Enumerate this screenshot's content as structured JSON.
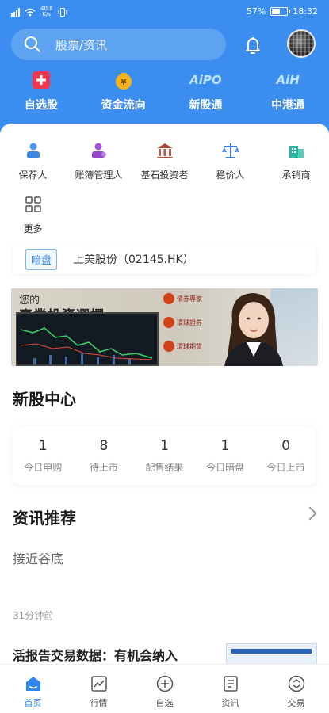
{
  "status_bar": {
    "network_speed": "40.8\nK/s",
    "battery_percent": "57%",
    "battery_level": 0.57,
    "time": "18:32"
  },
  "search": {
    "placeholder": "股票/资讯"
  },
  "quick_entries": [
    {
      "label": "自选股",
      "icon": "plus-square-icon"
    },
    {
      "label": "资金流向",
      "icon": "money-bag-icon"
    },
    {
      "label": "新股通",
      "icon": "aipo-icon",
      "glyph": "AiPO"
    },
    {
      "label": "中港通",
      "icon": "aih-icon",
      "glyph": "AiH"
    }
  ],
  "service_grid": [
    {
      "label": "保荐人",
      "icon": "sponsor-icon"
    },
    {
      "label": "账簿管理人",
      "icon": "bookrunner-icon"
    },
    {
      "label": "基石投资者",
      "icon": "bank-icon"
    },
    {
      "label": "稳价人",
      "icon": "scale-icon"
    },
    {
      "label": "承销商",
      "icon": "building-icon"
    },
    {
      "label": "更多",
      "icon": "grid-icon"
    }
  ],
  "dark_pool": {
    "tag": "暗盘",
    "stock": "上美股份（02145.HK）"
  },
  "banner": {
    "headline_small": "您的",
    "headline_big": "專業投資選擇",
    "items": [
      "債券專家",
      "環球證券",
      "環球期貨"
    ]
  },
  "ipo_center": {
    "title": "新股中心",
    "stats": [
      {
        "value": "1",
        "label": "今日申购"
      },
      {
        "value": "8",
        "label": "待上市"
      },
      {
        "value": "1",
        "label": "配售结果"
      },
      {
        "value": "1",
        "label": "今日暗盘"
      },
      {
        "value": "0",
        "label": "今日上市"
      }
    ]
  },
  "news": {
    "title": "资讯推荐",
    "first_title": "接近谷底",
    "time": "31分钟前",
    "second_title": "活报告交易数据：有机会纳入"
  },
  "tabs": [
    {
      "label": "首页",
      "icon": "home-icon",
      "active": true
    },
    {
      "label": "行情",
      "icon": "chart-icon",
      "active": false
    },
    {
      "label": "自选",
      "icon": "plus-circle-icon",
      "active": false
    },
    {
      "label": "资讯",
      "icon": "document-icon",
      "active": false
    },
    {
      "label": "交易",
      "icon": "trade-icon",
      "active": false
    }
  ],
  "colors": {
    "brand_blue": "#3b8ef0",
    "active_tab": "#2f86ec"
  }
}
